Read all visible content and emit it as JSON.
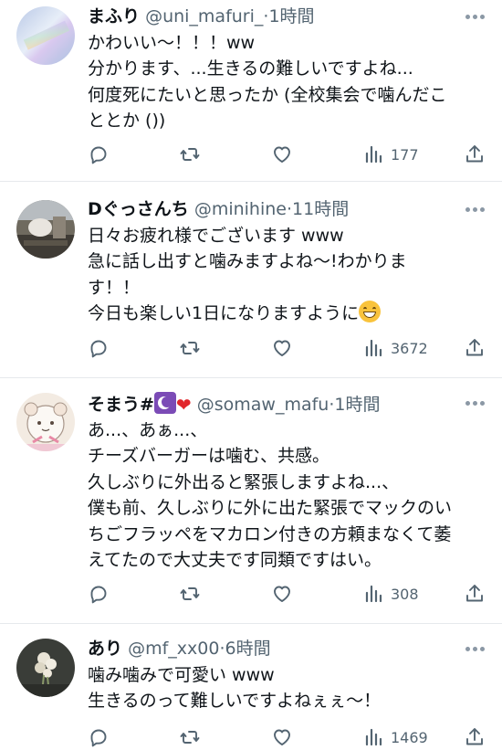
{
  "tweets": [
    {
      "name": "まふり",
      "handle": "@uni_mafuri_",
      "dot": "·",
      "time": "1時間",
      "lines": [
        "かわいい〜！！！ww",
        "分かります、...生きるの難しいですよね...",
        "何度死にたいと思ったか (全校集会で噛んだこ",
        "ととか ())"
      ],
      "views": "177",
      "avatar": "avatar-gradient"
    },
    {
      "name": "Dぐっさんち",
      "handle": "@minihine",
      "dot": "·",
      "time": "11時間",
      "lines": [
        "日々お疲れ様でございます www",
        "急に話し出すと噛みますよね〜!わかりま",
        "す！！",
        "今日も楽しい1日になりますように"
      ],
      "emoji": "grinning-face-emoji",
      "views": "3672",
      "avatar": "avatar-photo"
    },
    {
      "name": "そまう#",
      "name_emoji": [
        "star-and-crescent-emoji",
        "red-heart-emoji"
      ],
      "handle": "@somaw_mafu",
      "dot": "·",
      "time": "1時間",
      "lines": [
        "あ...、あぁ...、",
        "チーズバーガーは噛む、共感。",
        "久しぶりに外出ると緊張しますよね...、",
        "僕も前、久しぶりに外に出た緊張でマックのい",
        "ちごフラッペをマカロン付きの方頼まなくて萎",
        "えてたので大丈夫です同類ですはい。"
      ],
      "views": "308",
      "avatar": "avatar-illustration"
    },
    {
      "name": "あり",
      "handle": "@mf_xx00",
      "dot": "·",
      "time": "6時間",
      "lines": [
        "噛み噛みで可愛い www",
        "生きるのって難しいですよねぇぇ〜！"
      ],
      "views": "1469",
      "avatar": "avatar-flowers"
    }
  ],
  "icons": {
    "reply": "reply-icon",
    "retweet": "retweet-icon",
    "like": "heart-icon",
    "views": "views-icon",
    "share": "share-icon",
    "more": "more-icon"
  },
  "colors": {
    "text": "#0f1419",
    "secondary": "#536471",
    "divider": "#e6e9ec",
    "icon": "#536471"
  }
}
